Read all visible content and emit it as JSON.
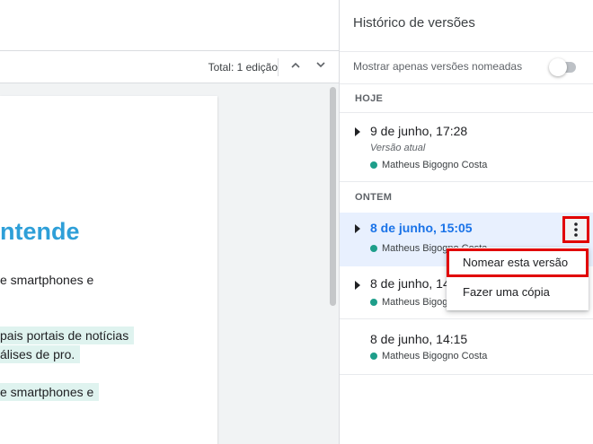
{
  "editbar": {
    "total_label": "Total: 1 edição"
  },
  "document": {
    "heading": "ntende",
    "line1": "e smartphones e",
    "line2": "pais portais de notícias",
    "line3": "álises de pro.",
    "line4": "e smartphones e"
  },
  "panel": {
    "title": "Histórico de versões",
    "named_only_label": "Mostrar apenas versões nomeadas",
    "named_only_enabled": false,
    "sections": [
      {
        "label": "HOJE",
        "versions": [
          {
            "date": "9 de junho, 17:28",
            "subtitle": "Versão atual",
            "author": "Matheus Bigogno Costa"
          }
        ]
      },
      {
        "label": "ONTEM",
        "versions": [
          {
            "date": "8 de junho, 15:05",
            "author": "Matheus Bigogno Costa",
            "selected": true
          },
          {
            "date": "8 de junho, 14:15",
            "author": "Matheus Bigogno Costa"
          },
          {
            "date": "8 de junho, 14:15",
            "author": "Matheus Bigogno Costa"
          }
        ]
      }
    ]
  },
  "context_menu": {
    "items": [
      {
        "label": "Nomear esta versão",
        "highlighted": true
      },
      {
        "label": "Fazer uma cópia"
      }
    ]
  },
  "colors": {
    "accent": "#1a73e8",
    "author_dot": "#1e9e8a",
    "heading": "#2e9fd8",
    "highlight_box": "#e10000"
  }
}
